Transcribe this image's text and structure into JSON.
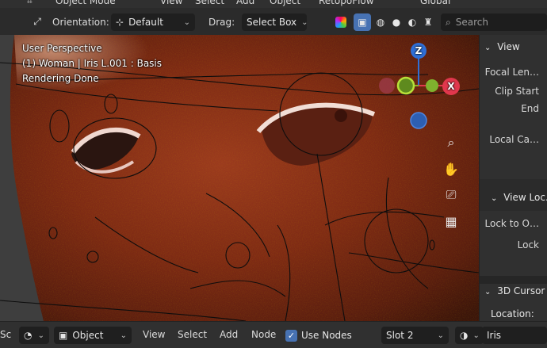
{
  "top_menu": {
    "mode": "Object Mode",
    "items": [
      "View",
      "Select",
      "Add",
      "Object"
    ],
    "addon": "RetopoFlow",
    "transform": "Global"
  },
  "tool_header": {
    "orientation_label": "Orientation:",
    "orientation_value": "Default",
    "drag_label": "Drag:",
    "drag_value": "Select Box",
    "search_placeholder": "Search"
  },
  "viewport": {
    "perspective": "User Perspective",
    "object_info": "(1) Woman | Iris L.001 : Basis",
    "render_status": "Rendering Done",
    "gizmo": {
      "z": "Z",
      "x": "X"
    }
  },
  "sidebar": {
    "view_header": "View",
    "focal_length": "Focal Len…",
    "clip_start": "Clip Start",
    "clip_end": "End",
    "local_camera": "Local Ca…",
    "view_lock_header": "View Loc…",
    "lock_to_object": "Lock to O…",
    "lock": "Lock",
    "cursor_header": "3D Cursor",
    "location": "Location:"
  },
  "bottom_bar": {
    "editor_type": "Sc",
    "object_type": "Object",
    "menu": [
      "View",
      "Select",
      "Add",
      "Node"
    ],
    "use_nodes_label": "Use Nodes",
    "use_nodes_checked": true,
    "slot": "Slot 2",
    "material": "Iris"
  },
  "colors": {
    "accent_blue": "#4772b3",
    "gizmo_z": "#2f6fd6",
    "gizmo_x": "#e0374d",
    "gizmo_y": "#86b82b"
  }
}
